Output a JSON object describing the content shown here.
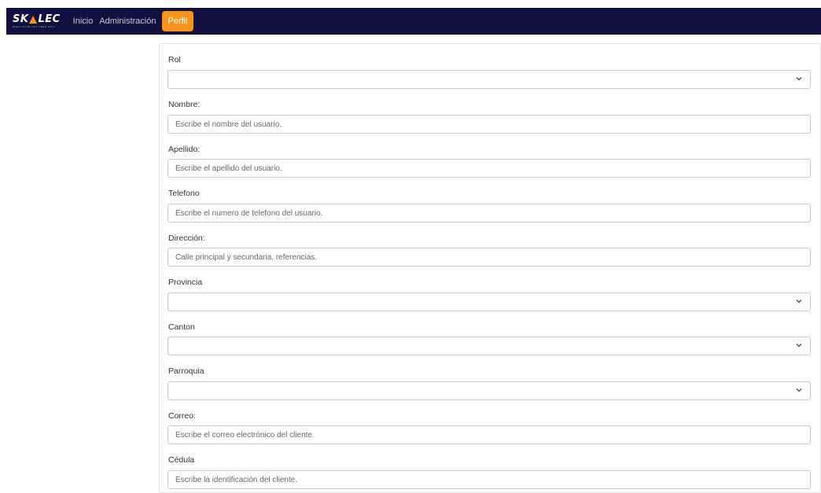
{
  "brand": {
    "name_pre": "SK",
    "name_post": "LEC",
    "tagline": "ELEC COTR TRC TREC ETIC"
  },
  "nav": {
    "items": [
      {
        "label": "Inicio"
      },
      {
        "label": "Administración"
      },
      {
        "label": "Perfil",
        "active": true
      }
    ]
  },
  "form": {
    "rol": {
      "label": "Rol",
      "value": ""
    },
    "nombre": {
      "label": "Nombre:",
      "placeholder": "Escribe el nombre del usuario."
    },
    "apellido": {
      "label": "Apellido:",
      "placeholder": "Escribe el apellido del usuario."
    },
    "telefono": {
      "label": "Telefono",
      "placeholder": "Escribe el numero de telefono del usuario."
    },
    "direccion": {
      "label": "Dirección:",
      "placeholder": "Calle principal y secundaria, referencias."
    },
    "provincia": {
      "label": "Provincia",
      "value": ""
    },
    "canton": {
      "label": "Canton",
      "value": ""
    },
    "parroquia": {
      "label": "Parroquia",
      "value": ""
    },
    "correo": {
      "label": "Correo:",
      "placeholder": "Escribe el correo electrónico del cliente."
    },
    "cedula": {
      "label": "Cédula",
      "placeholder": "Escribe la identificación del cliente."
    }
  },
  "colors": {
    "navbar": "#130f3e",
    "accent": "#f7941d"
  }
}
